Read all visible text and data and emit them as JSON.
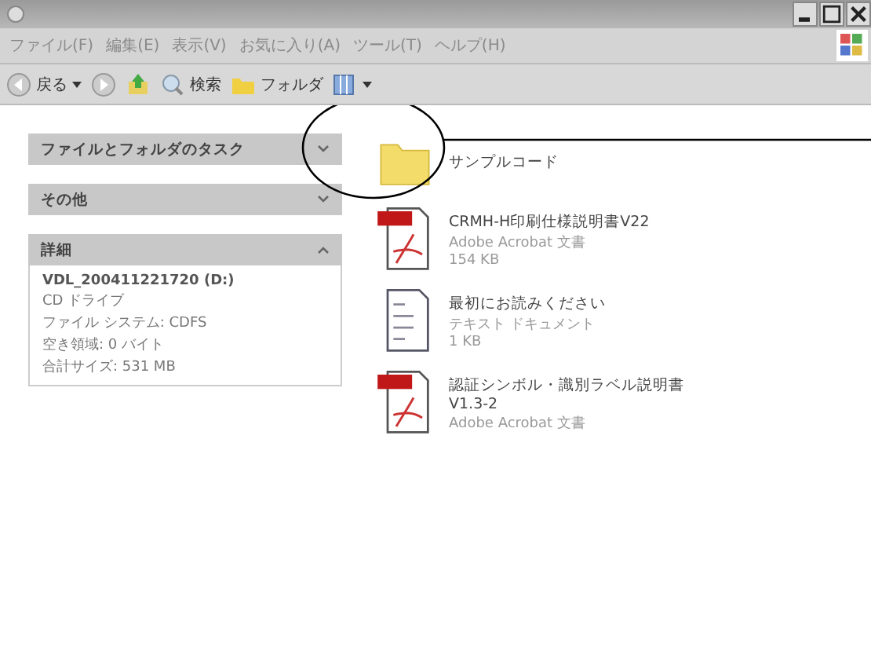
{
  "menu": [
    "ファイル(F)",
    "編集(E)",
    "表示(V)",
    "お気に入り(A)",
    "ツール(T)",
    "ヘルプ(H)"
  ],
  "toolbar": [
    {
      "kind": "back",
      "label": "戻る"
    },
    {
      "kind": "forward"
    },
    {
      "kind": "up"
    },
    {
      "kind": "search",
      "label": "検索"
    },
    {
      "kind": "folders",
      "label": "フォルダ"
    },
    {
      "kind": "views"
    }
  ],
  "panels": [
    {
      "title": "ファイルとフォルダのタスク",
      "expanded": false
    },
    {
      "title": "その他",
      "expanded": false
    },
    {
      "title": "詳細",
      "expanded": true,
      "lines": [
        "VDL_200411221720 (D:)",
        "CD ドライブ",
        "ファイル システム: CDFS",
        "空き領域: 0 バイト",
        "合計サイズ: 531 MB"
      ]
    }
  ],
  "files": [
    {
      "kind": "folder",
      "name": "サンプルコード"
    },
    {
      "kind": "pdf",
      "name": "CRMH-H印刷仕様説明書V22",
      "type": "Adobe Acrobat 文書",
      "size": "154 KB"
    },
    {
      "kind": "text",
      "name": "最初にお読みください",
      "type": "テキスト ドキュメント",
      "size": "1 KB"
    },
    {
      "kind": "pdf",
      "name": "認証シンボル・識別ラベル説明書",
      "name2": "V1.3-2",
      "type": "Adobe Acrobat 文書"
    }
  ]
}
